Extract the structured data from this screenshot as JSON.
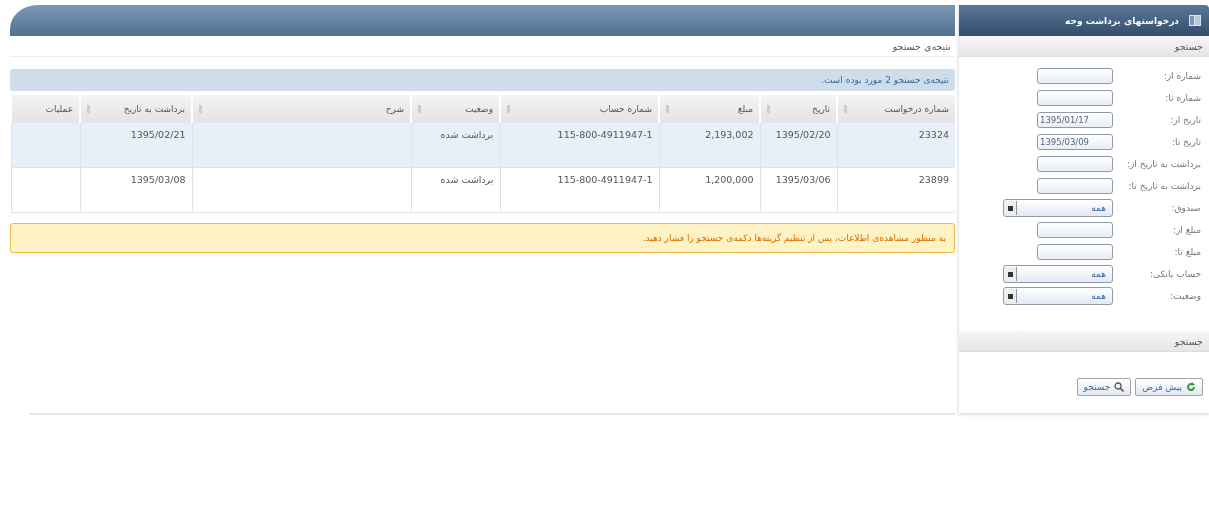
{
  "sidebar": {
    "title": "درخواستهای برداشت وجه",
    "search_header": "جستجو",
    "fields": [
      {
        "kind": "text",
        "label": "شماره از:"
      },
      {
        "kind": "text",
        "label": "شماره تا:"
      },
      {
        "kind": "text",
        "label": "تاریخ از:",
        "value": "1395/01/17"
      },
      {
        "kind": "text",
        "label": "تاریخ تا:",
        "value": "1395/03/09"
      },
      {
        "kind": "text",
        "label": "برداشت به تاریخ از:"
      },
      {
        "kind": "text",
        "label": "برداشت به تاریخ تا:"
      },
      {
        "kind": "select",
        "label": "صندوق:",
        "value": "همه"
      },
      {
        "kind": "text",
        "label": "مبلغ از:"
      },
      {
        "kind": "text",
        "label": "مبلغ تا:"
      },
      {
        "kind": "select",
        "label": "حساب بانکی:",
        "value": "همه"
      },
      {
        "kind": "select",
        "label": "وضعیت:",
        "value": "همه"
      }
    ],
    "second_header": "جستجو",
    "buttons": [
      {
        "kind": "reset",
        "label": "پیش فرض"
      },
      {
        "kind": "search",
        "label": "جستجو"
      }
    ]
  },
  "main": {
    "title": "نتیجه‌ی جستجو",
    "info": "نتیجه‌ی جستجو 2 مورد بوده است.",
    "table": {
      "columns": [
        "شماره درخواست",
        "تاریخ",
        "مبلغ",
        "شماره حساب",
        "وضعیت",
        "شرح",
        "برداشت به تاریخ",
        "عملیات"
      ],
      "rows": [
        {
          "selected": true,
          "cells": [
            "23324",
            "1395/02/20",
            "2,193,002",
            "115-800-4911947-1",
            "برداشت شده",
            null,
            "1395/02/21",
            null
          ]
        },
        {
          "selected": false,
          "cells": [
            "23899",
            "1395/03/06",
            "1,200,000",
            "115-800-4911947-1",
            "برداشت شده",
            null,
            "1395/03/08",
            null
          ]
        }
      ]
    },
    "warning": "به منظور مشاهده‌ی اطلاعات، پس از تنظیم گزینه‌ها دکمه‌ی جستجو را فشار دهید."
  }
}
